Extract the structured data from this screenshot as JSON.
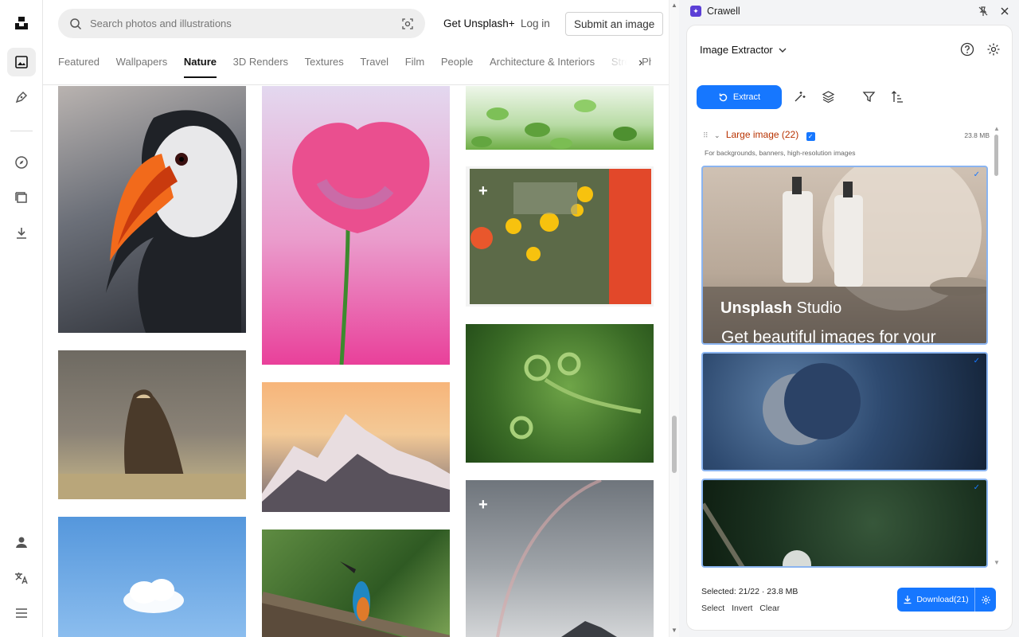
{
  "header": {
    "search_placeholder": "Search photos and illustrations",
    "get_plus": "Get Unsplash+",
    "login": "Log in",
    "submit": "Submit an image"
  },
  "categories": [
    "Featured",
    "Wallpapers",
    "Nature",
    "3D Renders",
    "Textures",
    "Travel",
    "Film",
    "People",
    "Architecture & Interiors",
    "Street Photography"
  ],
  "active_category": "Nature",
  "rail_icons": [
    "unsplash-logo-icon",
    "photos-icon",
    "illustrations-icon",
    "explore-icon",
    "collections-icon",
    "download-icon",
    "user-icon",
    "translate-icon",
    "menu-icon"
  ],
  "photos": [
    {
      "name": "puffin-photo",
      "colors": [
        "#5a5f68",
        "#2a2d33"
      ]
    },
    {
      "name": "eagle-photo",
      "colors": [
        "#8a8276",
        "#c9b88a"
      ]
    },
    {
      "name": "cloud-photo",
      "colors": [
        "#5fa0de",
        "#8fc0ee"
      ]
    },
    {
      "name": "poppy-photo",
      "colors": [
        "#e8d1e8",
        "#e93f9d"
      ]
    },
    {
      "name": "mountain-photo",
      "colors": [
        "#f4b27a",
        "#6f6672"
      ]
    },
    {
      "name": "kingfisher-photo",
      "colors": [
        "#3e6b2f",
        "#86a860"
      ]
    },
    {
      "name": "leaves-photo",
      "colors": [
        "#d7ecd0",
        "#6fae46"
      ]
    },
    {
      "name": "flowers-photo",
      "colors": [
        "#c0cbb0",
        "#e0502a"
      ]
    },
    {
      "name": "fern-photo",
      "colors": [
        "#2f5e1f",
        "#5b8c33"
      ]
    },
    {
      "name": "rainbow-photo",
      "colors": [
        "#8b9096",
        "#c9cdd1"
      ]
    }
  ],
  "panel": {
    "app_name": "Crawell",
    "tool_name": "Image Extractor",
    "extract_label": "Extract",
    "group_title": "Large image (22)",
    "group_size": "23.8 MB",
    "group_desc": "For backgrounds, banners, high-resolution images",
    "studio_brand": "Unsplash",
    "studio_word": "Studio",
    "studio_tagline": "Get beautiful images for your",
    "selected": "Selected: 21/22 · 23.8 MB",
    "select": "Select",
    "invert": "Invert",
    "clear": "Clear",
    "download": "Download(21)",
    "accent": "#1677ff",
    "group_color": "#b83200"
  }
}
